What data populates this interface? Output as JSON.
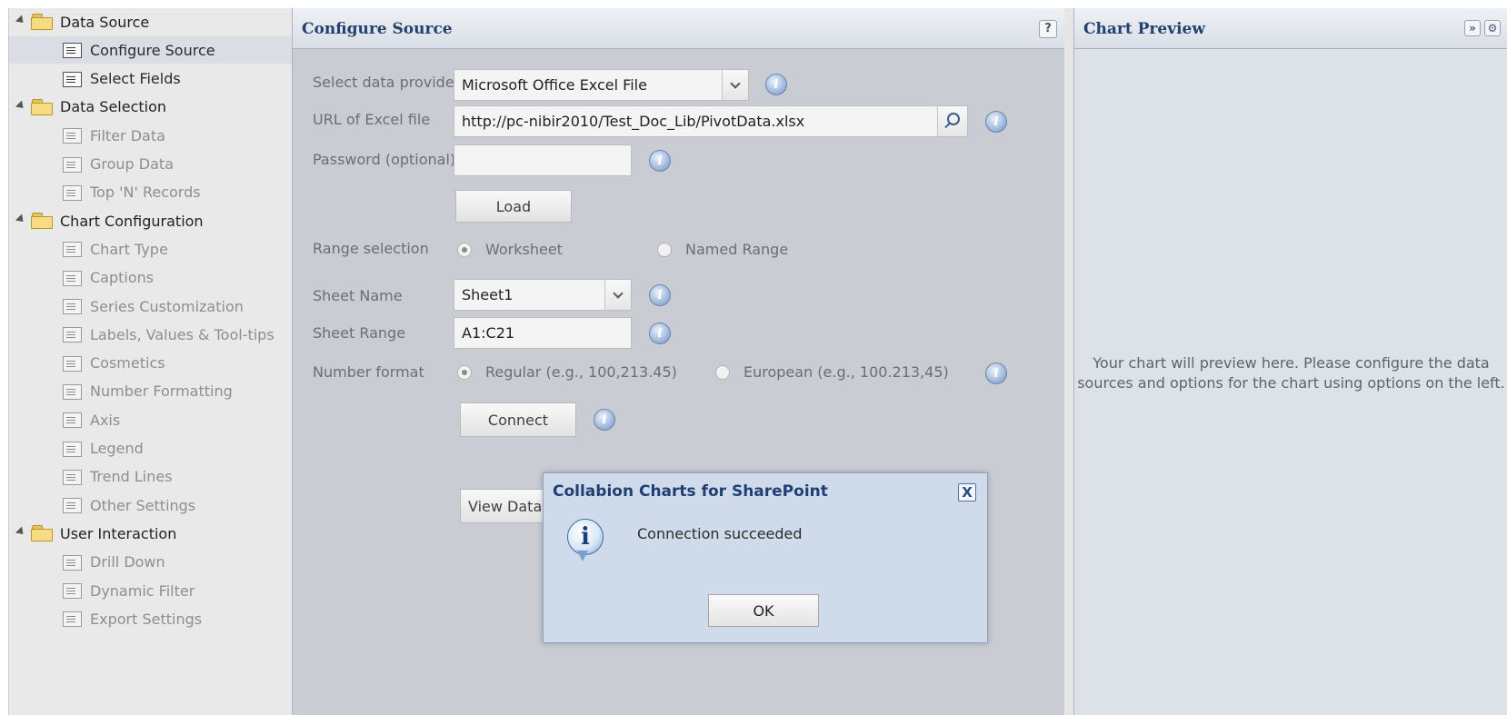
{
  "tree": [
    {
      "type": "group",
      "label": "Data Source"
    },
    {
      "type": "leaf",
      "label": "Configure Source",
      "active": true,
      "selected": true
    },
    {
      "type": "leaf",
      "label": "Select Fields",
      "active": true
    },
    {
      "type": "group",
      "label": "Data Selection"
    },
    {
      "type": "leaf",
      "label": "Filter Data"
    },
    {
      "type": "leaf",
      "label": "Group Data"
    },
    {
      "type": "leaf",
      "label": "Top 'N' Records"
    },
    {
      "type": "group",
      "label": "Chart Configuration"
    },
    {
      "type": "leaf",
      "label": "Chart Type"
    },
    {
      "type": "leaf",
      "label": "Captions"
    },
    {
      "type": "leaf",
      "label": "Series Customization"
    },
    {
      "type": "leaf",
      "label": "Labels, Values & Tool-tips"
    },
    {
      "type": "leaf",
      "label": "Cosmetics"
    },
    {
      "type": "leaf",
      "label": "Number Formatting"
    },
    {
      "type": "leaf",
      "label": "Axis"
    },
    {
      "type": "leaf",
      "label": "Legend"
    },
    {
      "type": "leaf",
      "label": "Trend Lines"
    },
    {
      "type": "leaf",
      "label": "Other Settings"
    },
    {
      "type": "group",
      "label": "User Interaction"
    },
    {
      "type": "leaf",
      "label": "Drill Down"
    },
    {
      "type": "leaf",
      "label": "Dynamic Filter"
    },
    {
      "type": "leaf",
      "label": "Export Settings"
    }
  ],
  "configure": {
    "title": "Configure Source",
    "help": "?",
    "provider_label": "Select data provider",
    "provider_value": "Microsoft Office Excel File",
    "url_label": "URL of Excel file",
    "url_value": "http://pc-nibir2010/Test_Doc_Lib/PivotData.xlsx",
    "password_label": "Password (optional)",
    "password_value": "",
    "load_label": "Load",
    "range_label": "Range selection",
    "range_options": [
      "Worksheet",
      "Named Range"
    ],
    "range_selected": "Worksheet",
    "sheet_name_label": "Sheet Name",
    "sheet_name_value": "Sheet1",
    "sheet_range_label": "Sheet Range",
    "sheet_range_value": "A1:C21",
    "number_format_label": "Number format",
    "number_format_options": [
      "Regular (e.g., 100,213.45)",
      "European (e.g., 100.213,45)"
    ],
    "number_format_selected": "Regular (e.g., 100,213.45)",
    "connect_label": "Connect",
    "view_data_label": "View Data"
  },
  "preview": {
    "title": "Chart Preview",
    "collapse_glyph": "»",
    "settings_glyph": "⚙",
    "message": "Your chart will preview here. Please configure the data sources and options for the chart using options on the left."
  },
  "dialog": {
    "title": "Collabion Charts for SharePoint",
    "close_glyph": "X",
    "icon_glyph": "i",
    "message": "Connection succeeded",
    "ok_label": "OK"
  },
  "info_glyph": "i",
  "colors": {
    "panel_title": "#23416f",
    "center_bg": "#c9cdd3",
    "tree_bg": "#e9e9e9",
    "dialog_bg": "#cfdbea"
  }
}
